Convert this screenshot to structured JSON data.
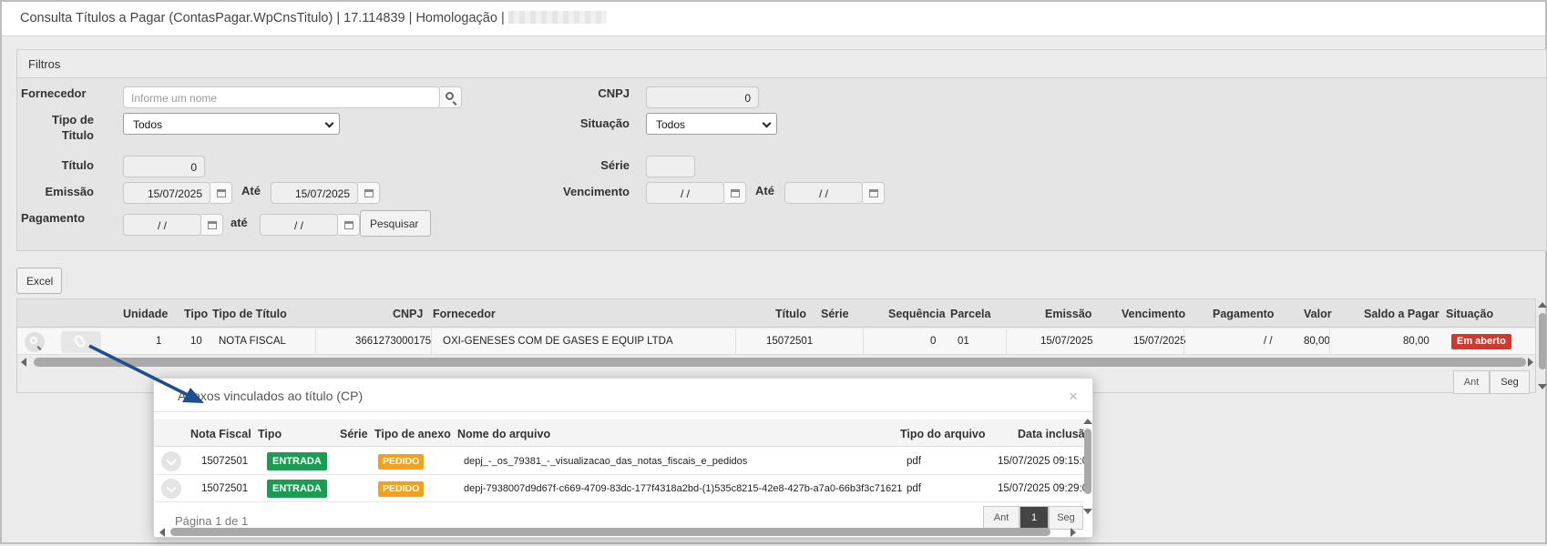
{
  "window": {
    "title": "Consulta Títulos a Pagar (ContasPagar.WpCnsTitulo) | 17.114839 | Homologação |"
  },
  "filters": {
    "section_title": "Filtros",
    "fornecedor_label": "Fornecedor",
    "fornecedor_placeholder": "Informe um nome",
    "cnpj_label": "CNPJ",
    "cnpj_value": "0",
    "tipo_titulo_label_1": "Tipo de",
    "tipo_titulo_label_2": "Titulo",
    "tipo_titulo_value": "Todos",
    "situacao_label": "Situação",
    "situacao_value": "Todos",
    "titulo_label": "Título",
    "titulo_value": "0",
    "serie_label": "Série",
    "serie_value": "",
    "emissao_label": "Emissão",
    "emissao_from": "15/07/2025",
    "ate_label": "Até",
    "emissao_to": "15/07/2025",
    "vencimento_label": "Vencimento",
    "vencimento_from": "/ /",
    "vencimento_to": "/ /",
    "pagamento_label": "Pagamento",
    "pagamento_from": "/ /",
    "ate_lower_label": "até",
    "pagamento_to": "/ /",
    "search_button": "Pesquisar"
  },
  "excel_button": "Excel",
  "results_grid": {
    "columns": [
      "Unidade",
      "Tipo",
      "Tipo de Título",
      "CNPJ",
      "Fornecedor",
      "Título",
      "Série",
      "Sequência",
      "Parcela",
      "Emissão",
      "Vencimento",
      "Pagamento",
      "Valor",
      "Saldo a Pagar",
      "Situação"
    ],
    "rows": [
      {
        "unidade": "1",
        "tipo": "10",
        "tipo_titulo": "NOTA FISCAL",
        "cnpj": "3661273000175",
        "fornecedor": "OXI-GENESES COM DE GASES E EQUIP LTDA",
        "titulo": "15072501",
        "serie": "",
        "sequencia": "0",
        "parcela": "01",
        "emissao": "15/07/2025",
        "vencimento": "15/07/2025",
        "pagamento": "/ /",
        "valor": "80,00",
        "saldo": "80,00",
        "situacao": "Em aberto"
      }
    ],
    "pager": {
      "prev": "Ant",
      "next": "Seg"
    }
  },
  "attachments_modal": {
    "title": "Anexos vinculados ao título (CP)",
    "close_glyph": "×",
    "columns": [
      "Nota Fiscal",
      "Tipo",
      "Série",
      "Tipo de anexo",
      "Nome do arquivo",
      "Tipo do arquivo",
      "Data inclusão"
    ],
    "rows": [
      {
        "nota_fiscal": "15072501",
        "tipo": "ENTRADA",
        "serie": "",
        "tipo_anexo": "PEDIDO",
        "nome_arquivo": "depj_-_os_79381_-_visualizacao_das_notas_fiscais_e_pedidos",
        "tipo_arquivo": "pdf",
        "data_inclusao": "15/07/2025 09:15:0"
      },
      {
        "nota_fiscal": "15072501",
        "tipo": "ENTRADA",
        "serie": "",
        "tipo_anexo": "PEDIDO",
        "nome_arquivo": "depj-7938007d9d67f-c669-4709-83dc-177f4318a2bd-(1)535c8215-42e8-427b-a7a0-66b3f3c71621",
        "tipo_arquivo": "pdf",
        "data_inclusao": "15/07/2025 09:29:0"
      }
    ],
    "footer_text": "Página 1 de 1",
    "pager": {
      "prev": "Ant",
      "current": "1",
      "next": "Seg"
    }
  },
  "colors": {
    "accent_red": "#d0392d",
    "tag_green": "#1b9c53",
    "tag_orange": "#f2a11b",
    "annotation_arrow": "#1f4e8c"
  }
}
